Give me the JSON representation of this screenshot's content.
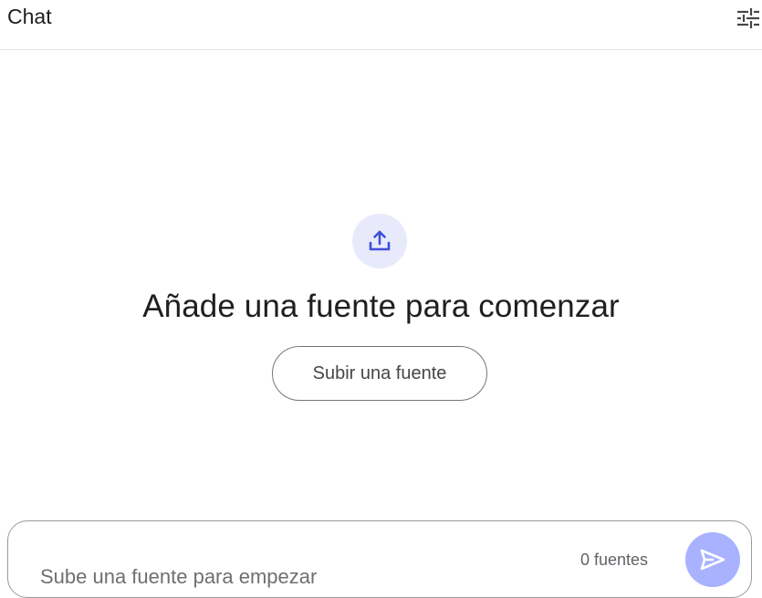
{
  "header": {
    "title": "Chat"
  },
  "empty_state": {
    "heading": "Añade una fuente para comenzar",
    "upload_button_label": "Subir una fuente"
  },
  "composer": {
    "placeholder": "Sube una fuente para empezar",
    "source_count": "0 fuentes"
  },
  "icons": {
    "settings": "tune-icon",
    "upload": "upload-icon",
    "send": "send-icon"
  },
  "colors": {
    "accent_icon": "#3f51d8",
    "upload_circle_bg": "#e8eafc",
    "send_button_bg": "#a8b2ff"
  }
}
